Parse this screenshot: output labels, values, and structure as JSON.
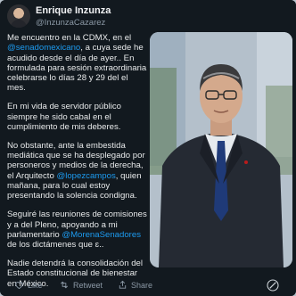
{
  "author": {
    "display_name": "Enrique Inzunza",
    "handle": "@InzunzaCazarez"
  },
  "tweet": {
    "p1_a": "Me encuentro en la CDMX, en el ",
    "p1_mention": "@senadomexicano",
    "p1_b": ", a cuya sede he acudido desde el día de ayer.. En formulada para sesión extraordinaria celebrarse lo días 28 y 29 del el mes.",
    "p2": "En mi vida de servidor público siempre he sido cabal en el cumplimiento de mis deberes.",
    "p3_a": "No obstante, ante la embestida mediática que se ha desplegado por personeros y medios de la derecha, el Arquitecto ",
    "p3_mention": "@lopezcampos",
    "p3_b": ", quien mañana, para lo cual estoy presentando la solencia condigna.",
    "p4_a": "Seguiré las reuniones de comisiones y a del Pleno, apoyando a mi parlamentario ",
    "p4_mention": "@MorenaSenadores",
    "p4_b": " de los dictámenes que ɛ..",
    "p5": "Nadie detendrá la consolidación del Estado constitucional de bienestar en México."
  },
  "actions": {
    "like_label": "Like",
    "retweet_label": "Retweet",
    "share_label": "Share"
  },
  "colors": {
    "background": "#12191f",
    "text": "#e7e9ea",
    "muted": "#8b98a5",
    "link": "#1d9bf0"
  },
  "icons": [
    "avatar",
    "heart-icon",
    "retweet-icon",
    "share-icon",
    "grok-icon"
  ]
}
